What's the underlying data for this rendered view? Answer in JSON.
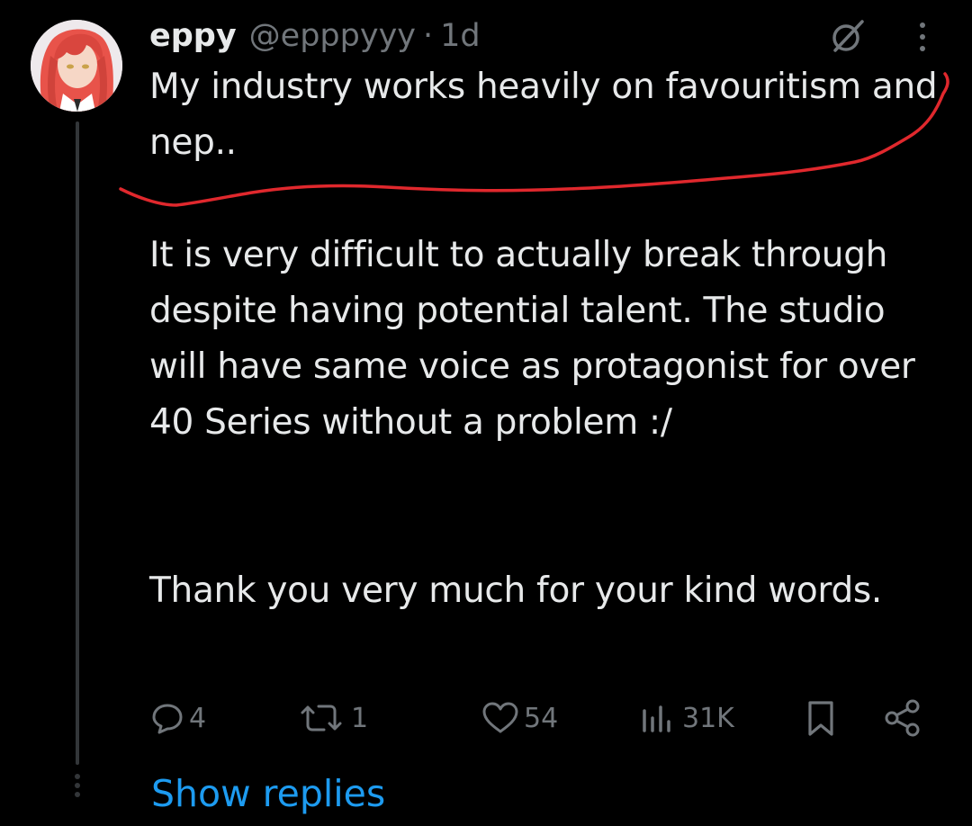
{
  "tweet": {
    "display_name": "eppy",
    "handle": "@epppyyy",
    "separator": "·",
    "time": "1d",
    "paragraphs": [
      "My industry works heavily on favouritism and nep..",
      "It is very difficult to actually break through despite having potential talent. The studio will have same voice as protagonist for over 40 Series without a problem :/",
      "Thank you very much for your kind words."
    ]
  },
  "actions": {
    "reply_count": "4",
    "retweet_count": "1",
    "like_count": "54",
    "views_count": "31K"
  },
  "show_replies_label": "Show replies",
  "colors": {
    "background": "#000000",
    "text": "#e7e9ea",
    "muted": "#71767b",
    "link": "#1d9bf0",
    "annotation": "#e0282d",
    "avatar_hair": "#e8534a"
  },
  "icons": {
    "grok": "grok-icon",
    "more": "more-icon",
    "reply": "reply-icon",
    "retweet": "retweet-icon",
    "like": "heart-icon",
    "views": "views-icon",
    "bookmark": "bookmark-icon",
    "share": "share-icon"
  }
}
